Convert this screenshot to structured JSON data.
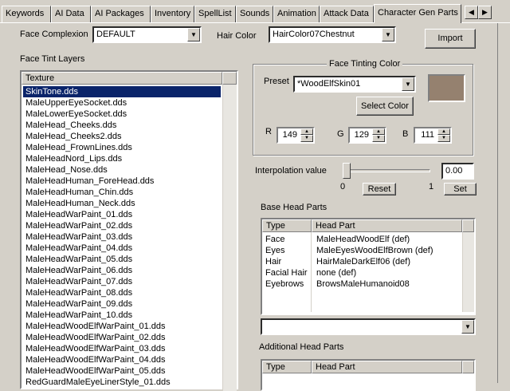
{
  "tabs": [
    {
      "label": "Keywords"
    },
    {
      "label": "AI Data"
    },
    {
      "label": "AI Packages"
    },
    {
      "label": "Inventory"
    },
    {
      "label": "SpellList"
    },
    {
      "label": "Sounds"
    },
    {
      "label": "Animation"
    },
    {
      "label": "Attack Data"
    },
    {
      "label": "Character Gen Parts"
    }
  ],
  "tab_scroll": {
    "left_arrow": "◀",
    "right_arrow": "▶"
  },
  "face_complexion": {
    "label": "Face Complexion",
    "value": "DEFAULT"
  },
  "hair_color": {
    "label": "Hair Color",
    "value": "HairColor07Chestnut"
  },
  "import_button": "Import",
  "face_tint_layers": {
    "label": "Face Tint Layers",
    "column": "Texture",
    "items": [
      "SkinTone.dds",
      "MaleUpperEyeSocket.dds",
      "MaleLowerEyeSocket.dds",
      "MaleHead_Cheeks.dds",
      "MaleHead_Cheeks2.dds",
      "MaleHead_FrownLines.dds",
      "MaleHeadNord_Lips.dds",
      "MaleHead_Nose.dds",
      "MaleHeadHuman_ForeHead.dds",
      "MaleHeadHuman_Chin.dds",
      "MaleHeadHuman_Neck.dds",
      "MaleHeadWarPaint_01.dds",
      "MaleHeadWarPaint_02.dds",
      "MaleHeadWarPaint_03.dds",
      "MaleHeadWarPaint_04.dds",
      "MaleHeadWarPaint_05.dds",
      "MaleHeadWarPaint_06.dds",
      "MaleHeadWarPaint_07.dds",
      "MaleHeadWarPaint_08.dds",
      "MaleHeadWarPaint_09.dds",
      "MaleHeadWarPaint_10.dds",
      "MaleHeadWoodElfWarPaint_01.dds",
      "MaleHeadWoodElfWarPaint_02.dds",
      "MaleHeadWoodElfWarPaint_03.dds",
      "MaleHeadWoodElfWarPaint_04.dds",
      "MaleHeadWoodElfWarPaint_05.dds",
      "RedGuardMaleEyeLinerStyle_01.dds"
    ]
  },
  "face_tinting": {
    "title": "Face Tinting Color",
    "preset_label": "Preset",
    "preset_value": "*WoodElfSkin01",
    "swatch_color": "#95816f",
    "select_color_button": "Select Color",
    "r_label": "R",
    "r_value": "149",
    "g_label": "G",
    "g_value": "129",
    "b_label": "B",
    "b_value": "111"
  },
  "interpolation": {
    "label": "Interpolation value",
    "value": "0.00",
    "slider_fraction": 0.0,
    "min_label": "0",
    "max_label": "1",
    "reset_button": "Reset",
    "set_button": "Set"
  },
  "base_head_parts": {
    "label": "Base Head Parts",
    "col_type": "Type",
    "col_part": "Head Part",
    "rows": [
      {
        "type": "Face",
        "part": "MaleHeadWoodElf (def)"
      },
      {
        "type": "Eyes",
        "part": "MaleEyesWoodElfBrown (def)"
      },
      {
        "type": "Hair",
        "part": "HairMaleDarkElf06 (def)"
      },
      {
        "type": "Facial Hair",
        "part": "none (def)"
      },
      {
        "type": "Eyebrows",
        "part": "BrowsMaleHumanoid08"
      }
    ],
    "dropdown_value": ""
  },
  "additional_head_parts": {
    "label": "Additional Head Parts",
    "col_type": "Type",
    "col_part": "Head Part"
  },
  "icons": {
    "dropdown": "chevron-down-icon",
    "spin_up": "triangle-up-icon",
    "spin_down": "triangle-down-icon"
  }
}
